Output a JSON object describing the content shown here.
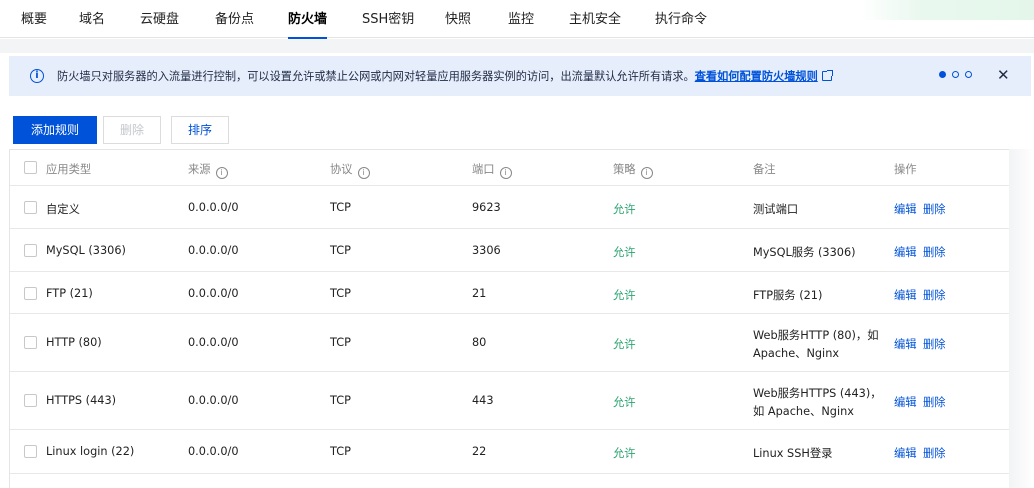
{
  "tabs": [
    "概要",
    "域名",
    "云硬盘",
    "备份点",
    "防火墙",
    "SSH密钥",
    "快照",
    "监控",
    "主机安全",
    "执行命令"
  ],
  "active_tab": "防火墙",
  "notice": {
    "icon": "info-circle-icon",
    "text": "防火墙只对服务器的入流量进行控制，可以设置允许或禁止公网或内网对轻量应用服务器实例的访问，出流量默认允许所有请求。",
    "link": "查看如何配置防火墙规则",
    "close": "✕"
  },
  "toolbar": {
    "add_label": "添加规则",
    "delete_label": "删除",
    "sort_label": "排序"
  },
  "table": {
    "headers": {
      "type": "应用类型",
      "source": "来源",
      "protocol": "协议",
      "port": "端口",
      "policy": "策略",
      "note": "备注",
      "ops": "操作"
    },
    "info_glyph": "i",
    "rows": [
      {
        "type": "自定义",
        "source": "0.0.0.0/0",
        "protocol": "TCP",
        "port": "9623",
        "policy": "允许",
        "note1": "测试端口",
        "note2": "",
        "edit": "编辑",
        "del": "删除"
      },
      {
        "type": "MySQL (3306)",
        "source": "0.0.0.0/0",
        "protocol": "TCP",
        "port": "3306",
        "policy": "允许",
        "note1": "MySQL服务 (3306)",
        "note2": "",
        "edit": "编辑",
        "del": "删除"
      },
      {
        "type": "FTP (21)",
        "source": "0.0.0.0/0",
        "protocol": "TCP",
        "port": "21",
        "policy": "允许",
        "note1": "FTP服务 (21)",
        "note2": "",
        "edit": "编辑",
        "del": "删除"
      },
      {
        "type": "HTTP (80)",
        "source": "0.0.0.0/0",
        "protocol": "TCP",
        "port": "80",
        "policy": "允许",
        "note1": "Web服务HTTP (80)，如",
        "note2": "Apache、Nginx",
        "edit": "编辑",
        "del": "删除"
      },
      {
        "type": "HTTPS (443)",
        "source": "0.0.0.0/0",
        "protocol": "TCP",
        "port": "443",
        "policy": "允许",
        "note1": "Web服务HTTPS (443)，",
        "note2": "如 Apache、Nginx",
        "edit": "编辑",
        "del": "删除"
      },
      {
        "type": "Linux login (22)",
        "source": "0.0.0.0/0",
        "protocol": "TCP",
        "port": "22",
        "policy": "允许",
        "note1": "Linux SSH登录",
        "note2": "",
        "edit": "编辑",
        "del": "删除"
      }
    ]
  },
  "colors": {
    "primary": "#0052d9",
    "allow": "#2ba471",
    "notice_bg": "#e6eefc"
  }
}
